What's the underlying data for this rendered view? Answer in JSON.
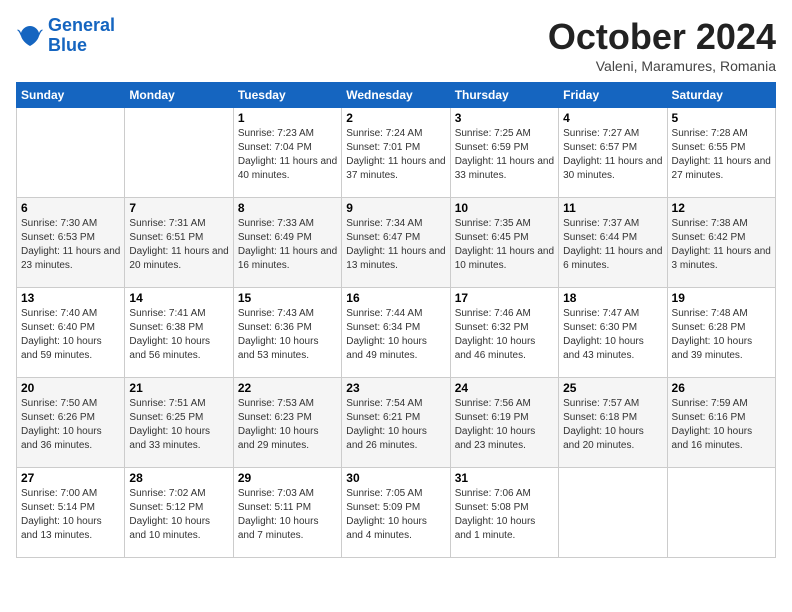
{
  "header": {
    "logo_line1": "General",
    "logo_line2": "Blue",
    "month": "October 2024",
    "location": "Valeni, Maramures, Romania"
  },
  "weekdays": [
    "Sunday",
    "Monday",
    "Tuesday",
    "Wednesday",
    "Thursday",
    "Friday",
    "Saturday"
  ],
  "weeks": [
    [
      {
        "day": "",
        "info": ""
      },
      {
        "day": "",
        "info": ""
      },
      {
        "day": "1",
        "info": "Sunrise: 7:23 AM\nSunset: 7:04 PM\nDaylight: 11 hours and 40 minutes."
      },
      {
        "day": "2",
        "info": "Sunrise: 7:24 AM\nSunset: 7:01 PM\nDaylight: 11 hours and 37 minutes."
      },
      {
        "day": "3",
        "info": "Sunrise: 7:25 AM\nSunset: 6:59 PM\nDaylight: 11 hours and 33 minutes."
      },
      {
        "day": "4",
        "info": "Sunrise: 7:27 AM\nSunset: 6:57 PM\nDaylight: 11 hours and 30 minutes."
      },
      {
        "day": "5",
        "info": "Sunrise: 7:28 AM\nSunset: 6:55 PM\nDaylight: 11 hours and 27 minutes."
      }
    ],
    [
      {
        "day": "6",
        "info": "Sunrise: 7:30 AM\nSunset: 6:53 PM\nDaylight: 11 hours and 23 minutes."
      },
      {
        "day": "7",
        "info": "Sunrise: 7:31 AM\nSunset: 6:51 PM\nDaylight: 11 hours and 20 minutes."
      },
      {
        "day": "8",
        "info": "Sunrise: 7:33 AM\nSunset: 6:49 PM\nDaylight: 11 hours and 16 minutes."
      },
      {
        "day": "9",
        "info": "Sunrise: 7:34 AM\nSunset: 6:47 PM\nDaylight: 11 hours and 13 minutes."
      },
      {
        "day": "10",
        "info": "Sunrise: 7:35 AM\nSunset: 6:45 PM\nDaylight: 11 hours and 10 minutes."
      },
      {
        "day": "11",
        "info": "Sunrise: 7:37 AM\nSunset: 6:44 PM\nDaylight: 11 hours and 6 minutes."
      },
      {
        "day": "12",
        "info": "Sunrise: 7:38 AM\nSunset: 6:42 PM\nDaylight: 11 hours and 3 minutes."
      }
    ],
    [
      {
        "day": "13",
        "info": "Sunrise: 7:40 AM\nSunset: 6:40 PM\nDaylight: 10 hours and 59 minutes."
      },
      {
        "day": "14",
        "info": "Sunrise: 7:41 AM\nSunset: 6:38 PM\nDaylight: 10 hours and 56 minutes."
      },
      {
        "day": "15",
        "info": "Sunrise: 7:43 AM\nSunset: 6:36 PM\nDaylight: 10 hours and 53 minutes."
      },
      {
        "day": "16",
        "info": "Sunrise: 7:44 AM\nSunset: 6:34 PM\nDaylight: 10 hours and 49 minutes."
      },
      {
        "day": "17",
        "info": "Sunrise: 7:46 AM\nSunset: 6:32 PM\nDaylight: 10 hours and 46 minutes."
      },
      {
        "day": "18",
        "info": "Sunrise: 7:47 AM\nSunset: 6:30 PM\nDaylight: 10 hours and 43 minutes."
      },
      {
        "day": "19",
        "info": "Sunrise: 7:48 AM\nSunset: 6:28 PM\nDaylight: 10 hours and 39 minutes."
      }
    ],
    [
      {
        "day": "20",
        "info": "Sunrise: 7:50 AM\nSunset: 6:26 PM\nDaylight: 10 hours and 36 minutes."
      },
      {
        "day": "21",
        "info": "Sunrise: 7:51 AM\nSunset: 6:25 PM\nDaylight: 10 hours and 33 minutes."
      },
      {
        "day": "22",
        "info": "Sunrise: 7:53 AM\nSunset: 6:23 PM\nDaylight: 10 hours and 29 minutes."
      },
      {
        "day": "23",
        "info": "Sunrise: 7:54 AM\nSunset: 6:21 PM\nDaylight: 10 hours and 26 minutes."
      },
      {
        "day": "24",
        "info": "Sunrise: 7:56 AM\nSunset: 6:19 PM\nDaylight: 10 hours and 23 minutes."
      },
      {
        "day": "25",
        "info": "Sunrise: 7:57 AM\nSunset: 6:18 PM\nDaylight: 10 hours and 20 minutes."
      },
      {
        "day": "26",
        "info": "Sunrise: 7:59 AM\nSunset: 6:16 PM\nDaylight: 10 hours and 16 minutes."
      }
    ],
    [
      {
        "day": "27",
        "info": "Sunrise: 7:00 AM\nSunset: 5:14 PM\nDaylight: 10 hours and 13 minutes."
      },
      {
        "day": "28",
        "info": "Sunrise: 7:02 AM\nSunset: 5:12 PM\nDaylight: 10 hours and 10 minutes."
      },
      {
        "day": "29",
        "info": "Sunrise: 7:03 AM\nSunset: 5:11 PM\nDaylight: 10 hours and 7 minutes."
      },
      {
        "day": "30",
        "info": "Sunrise: 7:05 AM\nSunset: 5:09 PM\nDaylight: 10 hours and 4 minutes."
      },
      {
        "day": "31",
        "info": "Sunrise: 7:06 AM\nSunset: 5:08 PM\nDaylight: 10 hours and 1 minute."
      },
      {
        "day": "",
        "info": ""
      },
      {
        "day": "",
        "info": ""
      }
    ]
  ]
}
